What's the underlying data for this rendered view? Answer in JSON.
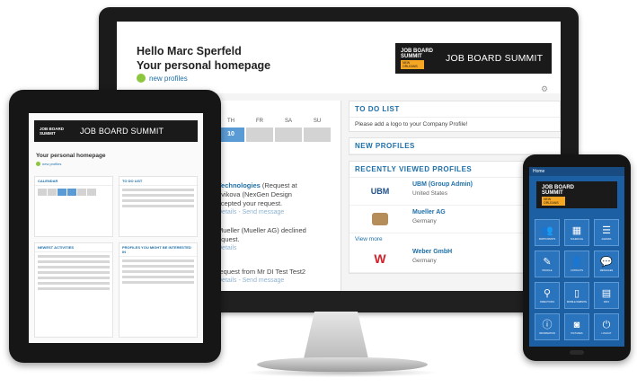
{
  "monitor": {
    "greeting": "Hello Marc Sperfeld",
    "subtitle": "Your personal homepage",
    "new_profiles_link": "new profiles",
    "banner": {
      "logo_line1": "JOB BOARD",
      "logo_line2": "SUMMIT",
      "logo_tag": "NEW ORLEANS",
      "title": "JOB BOARD SUMMIT"
    },
    "calendar": {
      "days": [
        "TH",
        "FR",
        "SA",
        "SU"
      ],
      "dates": [
        "10",
        "",
        "",
        ""
      ]
    },
    "activities": [
      {
        "title": "Technologies",
        "meta": "(Request at",
        "line2": "ovikova (NexGen Design",
        "line3": "ccepted your request.",
        "links": "Details - Send message"
      },
      {
        "title": "",
        "meta": "",
        "line2": "Mueller (Mueller AG) declined",
        "line3": "equest.",
        "links": "Details"
      },
      {
        "title": "",
        "meta": "",
        "line2": "request from Mr DI Test Test2",
        "line3": "",
        "links": "Details - Send message"
      }
    ],
    "todo": {
      "header": "TO DO LIST",
      "item": "Please add a logo to your Company Profile!"
    },
    "new_profiles_header": "NEW PROFILES",
    "recently_viewed": {
      "header": "RECENTLY VIEWED PROFILES",
      "items": [
        {
          "logo": "UBM",
          "name": "UBM (Group Admin)",
          "location": "United States"
        },
        {
          "logo": "",
          "name": "Mueller AG",
          "location": "Germany"
        },
        {
          "logo": "W",
          "name": "Weber GmbH",
          "location": "Germany"
        }
      ],
      "view_more": "View more"
    }
  },
  "tablet": {
    "banner_title": "JOB BOARD SUMMIT",
    "subtitle": "Your personal homepage",
    "panels": {
      "calendar": "CALENDAR",
      "todo": "TO DO LIST",
      "activities": "NEWEST ACTIVITIES",
      "profiles": "PROFILES YOU MIGHT BE INTERESTED IN"
    }
  },
  "phone": {
    "top_label": "Home",
    "tiles": [
      {
        "icon": "people-icon",
        "glyph": "👥",
        "label": "Participants"
      },
      {
        "icon": "calendar-icon",
        "glyph": "▦",
        "label": "Schedule"
      },
      {
        "icon": "list-icon",
        "glyph": "☰",
        "label": "Agenda"
      },
      {
        "icon": "pencil-icon",
        "glyph": "✎",
        "label": "Profile"
      },
      {
        "icon": "contacts-icon",
        "glyph": "👤",
        "label": "Contacts"
      },
      {
        "icon": "chat-icon",
        "glyph": "💬",
        "label": "Messages"
      },
      {
        "icon": "map-icon",
        "glyph": "⚲",
        "label": "Directions"
      },
      {
        "icon": "mobile-icon",
        "glyph": "▯",
        "label": "Mobile Website"
      },
      {
        "icon": "grid-icon",
        "glyph": "▤",
        "label": "Info"
      },
      {
        "icon": "info-icon",
        "glyph": "ⓘ",
        "label": "Information"
      },
      {
        "icon": "camera-icon",
        "glyph": "◙",
        "label": "Pictures"
      },
      {
        "icon": "power-icon",
        "glyph": "⏻",
        "label": "Logout"
      }
    ]
  },
  "colors": {
    "accent": "#1e6fa8",
    "banner_bg": "#1a1a1a",
    "logo_tag": "#f5a623",
    "phone_bg": "#1d5fa3"
  }
}
